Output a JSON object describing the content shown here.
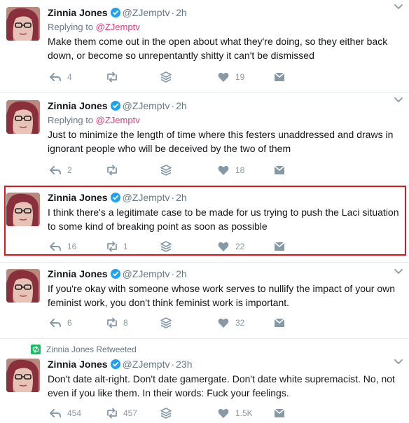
{
  "tweets": [
    {
      "name": "Zinnia Jones",
      "handle": "@ZJemptv",
      "time": "2h",
      "replying_label": "Replying to",
      "replying_to": "@ZJemptv",
      "text": "Make them come out in the open about what they're doing, so they either back down, or become so unrepentantly shitty it can't be dismissed",
      "replies": "4",
      "retweets": "",
      "likes": "19"
    },
    {
      "name": "Zinnia Jones",
      "handle": "@ZJemptv",
      "time": "2h",
      "replying_label": "Replying to",
      "replying_to": "@ZJemptv",
      "text": "Just to minimize the length of time where this festers unaddressed and draws in ignorant people who will be deceived by the two of them",
      "replies": "2",
      "retweets": "",
      "likes": "18"
    },
    {
      "name": "Zinnia Jones",
      "handle": "@ZJemptv",
      "time": "2h",
      "text": "I think there's a legitimate case to be made for us trying to push the Laci situation to some kind of breaking point as soon as possible",
      "replies": "16",
      "retweets": "1",
      "likes": "22"
    },
    {
      "name": "Zinnia Jones",
      "handle": "@ZJemptv",
      "time": "2h",
      "text": "If you're okay with someone whose work serves to nullify the impact of your own feminist work, you don't think feminist work is important.",
      "replies": "6",
      "retweets": "8",
      "likes": "32"
    },
    {
      "retweeted_label": "Zinnia Jones Retweeted",
      "name": "Zinnia Jones",
      "handle": "@ZJemptv",
      "time": "23h",
      "text": "Don't date alt-right. Don't date gamergate. Don't date white supremacist. No, not even if you like them. In their words: Fuck your feelings.",
      "replies": "454",
      "retweets": "457",
      "likes": "1.5K"
    }
  ],
  "colors": {
    "accent": "#dd3c7a",
    "verified": "#1da1f2",
    "highlight_border": "#e0161a",
    "retweet_badge": "#17bf63",
    "muted": "#657786",
    "icon": "#8899a6"
  }
}
